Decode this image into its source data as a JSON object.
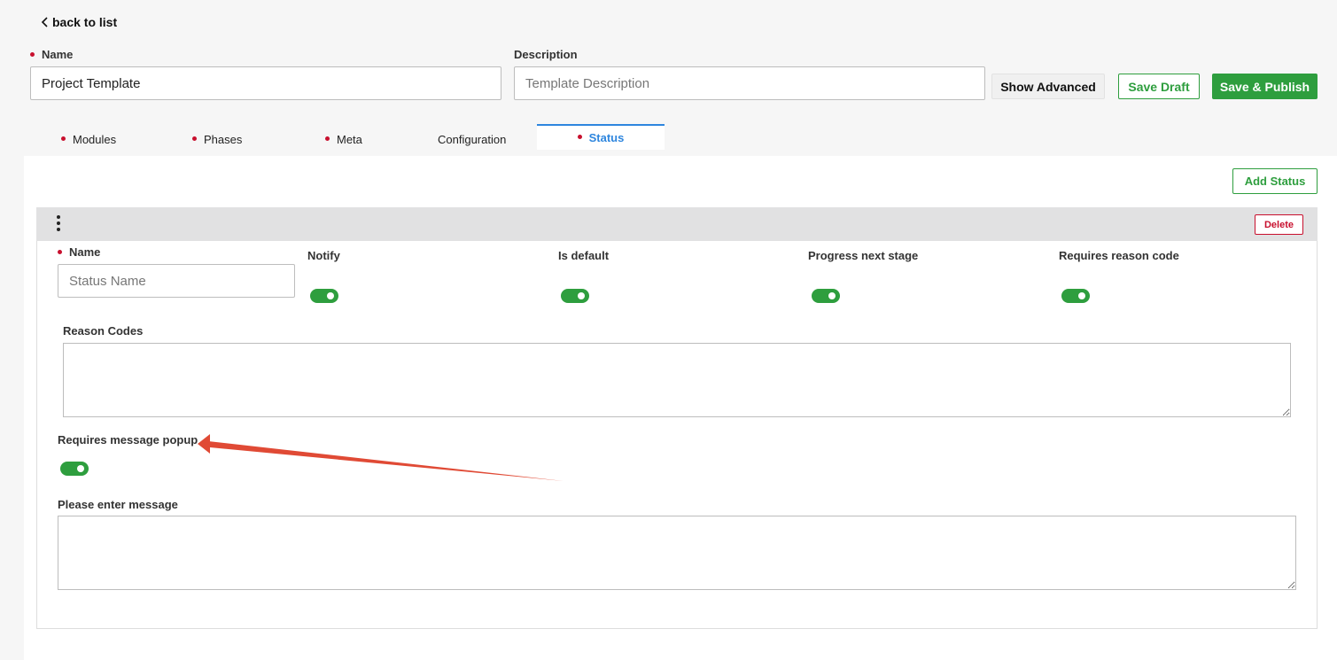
{
  "nav": {
    "back_label": "back to list"
  },
  "form": {
    "name_label": "Name",
    "name_value": "Project Template",
    "description_label": "Description",
    "description_placeholder": "Template Description"
  },
  "actions": {
    "show_advanced": "Show Advanced",
    "save_draft": "Save Draft",
    "save_publish": "Save & Publish"
  },
  "tabs": [
    {
      "label": "Modules",
      "required": true
    },
    {
      "label": "Phases",
      "required": true
    },
    {
      "label": "Meta",
      "required": true
    },
    {
      "label": "Configuration",
      "required": false
    },
    {
      "label": "Status",
      "required": true,
      "active": true
    }
  ],
  "status": {
    "add_button": "Add Status",
    "delete_button": "Delete",
    "name_label": "Name",
    "name_placeholder": "Status Name",
    "toggles": [
      {
        "label": "Notify",
        "on": true
      },
      {
        "label": "Is default",
        "on": true
      },
      {
        "label": "Progress next stage",
        "on": true
      },
      {
        "label": "Requires reason code",
        "on": true
      }
    ],
    "reason_codes_label": "Reason Codes",
    "message_popup_label": "Requires message popup",
    "message_popup_on": true,
    "message_label": "Please enter message"
  },
  "colors": {
    "accent_green": "#2e9e3e",
    "tab_active": "#2e86de",
    "required_dot": "#c8102e",
    "delete_red": "#c8102e",
    "annotation_arrow": "#e04a35"
  }
}
